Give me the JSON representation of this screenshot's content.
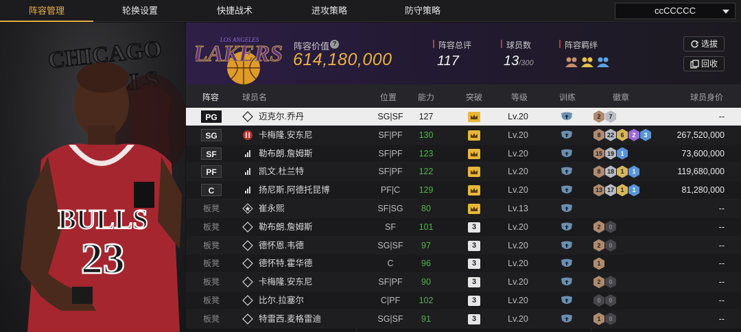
{
  "nav": {
    "tabs": [
      {
        "label": "阵容管理",
        "active": true
      },
      {
        "label": "轮换设置",
        "active": false
      },
      {
        "label": "快捷战术",
        "active": false
      },
      {
        "label": "进攻策略",
        "active": false
      },
      {
        "label": "防守策略",
        "active": false
      }
    ],
    "team_selector": "ccCCCCC"
  },
  "hero": {
    "jersey_team": "BULLS",
    "jersey_number": "23",
    "backdrop_text_1": "CHICAGO",
    "backdrop_text_2": "BULLS"
  },
  "header": {
    "team_logo_text": "LAKERS",
    "team_logo_subtext": "LOS ANGELES",
    "lineup_value_label": "阵容价值",
    "lineup_value": "614,180,000",
    "total_rating_label": "阵容总评",
    "total_rating": "117",
    "player_count_label": "球员数",
    "player_count": "13",
    "player_count_max": "/300",
    "bonds_label": "阵容羁绊",
    "select_button": "选拔",
    "recycle_button": "回收"
  },
  "table": {
    "headers": {
      "lineup": "阵容",
      "name": "球员名",
      "position": "位置",
      "ability": "能力",
      "breakthrough": "突破",
      "level": "等级",
      "training": "训练",
      "badges": "徽章",
      "value": "球员身价"
    },
    "rows": [
      {
        "slot": "PG",
        "starter": true,
        "icon": "copy",
        "name": "迈克尔.乔丹",
        "pos": "SG|SF",
        "ability": "127",
        "brk": "crown",
        "level": "Lv.20",
        "badges": [
          [
            "bronze",
            "2"
          ],
          [
            "silver",
            "7"
          ]
        ],
        "value": "--",
        "selected": true
      },
      {
        "slot": "SG",
        "starter": true,
        "icon": "bars-red",
        "name": "卡梅隆.安东尼",
        "pos": "SF|PF",
        "ability": "130",
        "brk": "crown",
        "level": "Lv.20",
        "badges": [
          [
            "bronze",
            "8"
          ],
          [
            "silver",
            "22"
          ],
          [
            "gold",
            "6"
          ],
          [
            "purple",
            "2"
          ],
          [
            "blue",
            "3"
          ]
        ],
        "value": "267,520,000"
      },
      {
        "slot": "SF",
        "starter": true,
        "icon": "bars",
        "name": "勒布朗.詹姆斯",
        "pos": "SF|PF",
        "ability": "123",
        "brk": "crown",
        "level": "Lv.20",
        "badges": [
          [
            "bronze",
            "15"
          ],
          [
            "silver",
            "19"
          ],
          [
            "blue",
            "1"
          ]
        ],
        "value": "73,600,000"
      },
      {
        "slot": "PF",
        "starter": true,
        "icon": "bars",
        "name": "凯文.杜兰特",
        "pos": "SF|PF",
        "ability": "122",
        "brk": "crown",
        "level": "Lv.20",
        "badges": [
          [
            "bronze",
            "8"
          ],
          [
            "silver",
            "18"
          ],
          [
            "gold",
            "1"
          ],
          [
            "blue",
            "1"
          ]
        ],
        "value": "119,680,000"
      },
      {
        "slot": "C",
        "starter": true,
        "icon": "bars",
        "name": "扬尼斯.阿德托昆博",
        "pos": "PF|C",
        "ability": "129",
        "brk": "crown",
        "level": "Lv.20",
        "badges": [
          [
            "bronze",
            "13"
          ],
          [
            "silver",
            "17"
          ],
          [
            "gold",
            "1"
          ],
          [
            "blue",
            "1"
          ]
        ],
        "value": "81,280,000"
      },
      {
        "slot": "板凳",
        "starter": false,
        "icon": "star",
        "name": "崔永熙",
        "pos": "SF|SG",
        "ability": "80",
        "brk": "crown",
        "level": "Lv.13",
        "badges": [],
        "value": "--"
      },
      {
        "slot": "板凳",
        "starter": false,
        "icon": "copy",
        "name": "勒布朗.詹姆斯",
        "pos": "SF",
        "ability": "101",
        "brk": "3",
        "level": "Lv.20",
        "badges": [
          [
            "bronze",
            "2"
          ],
          [
            "dark",
            "0"
          ]
        ],
        "value": "--"
      },
      {
        "slot": "板凳",
        "starter": false,
        "icon": "copy",
        "name": "德怀恩.韦德",
        "pos": "SG|SF",
        "ability": "97",
        "brk": "3",
        "level": "Lv.20",
        "badges": [
          [
            "bronze",
            "2"
          ],
          [
            "dark",
            "0"
          ]
        ],
        "value": "--"
      },
      {
        "slot": "板凳",
        "starter": false,
        "icon": "copy",
        "name": "德怀特.霍华德",
        "pos": "C",
        "ability": "96",
        "brk": "3",
        "level": "Lv.20",
        "badges": [
          [
            "bronze",
            "1"
          ]
        ],
        "value": "--"
      },
      {
        "slot": "板凳",
        "starter": false,
        "icon": "copy",
        "name": "卡梅隆.安东尼",
        "pos": "SF|PF",
        "ability": "90",
        "brk": "3",
        "level": "Lv.20",
        "badges": [
          [
            "bronze",
            "2"
          ],
          [
            "dark",
            "0"
          ]
        ],
        "value": "--"
      },
      {
        "slot": "板凳",
        "starter": false,
        "icon": "copy",
        "name": "比尔.拉塞尔",
        "pos": "C|PF",
        "ability": "102",
        "brk": "3",
        "level": "Lv.20",
        "badges": [
          [
            "dark",
            "0"
          ],
          [
            "dark",
            "0"
          ]
        ],
        "value": "--"
      },
      {
        "slot": "板凳",
        "starter": false,
        "icon": "copy",
        "name": "特雷西.麦格雷迪",
        "pos": "SG|SF",
        "ability": "91",
        "brk": "3",
        "level": "Lv.20",
        "badges": [
          [
            "bronze",
            "1"
          ],
          [
            "dark",
            "0"
          ]
        ],
        "value": "--"
      }
    ]
  },
  "colors": {
    "accent": "#e9b046",
    "ability_green": "#52b34a",
    "header_purple": "#2e1f47",
    "red_marker": "#c23a3a"
  }
}
